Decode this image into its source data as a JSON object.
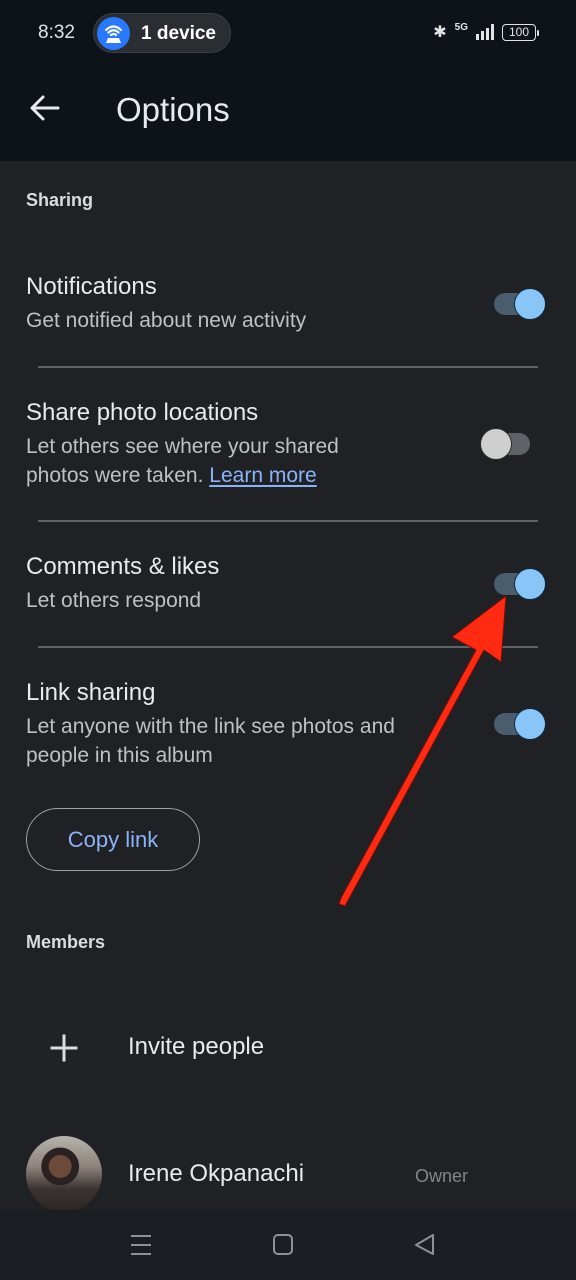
{
  "status_bar": {
    "time": "8:32",
    "hotspot_pill": {
      "icon": "wifi-hotspot-icon",
      "label": "1 device"
    },
    "network": "5G",
    "battery": "100"
  },
  "app_bar": {
    "back_icon": "arrow-back-icon",
    "title": "Options"
  },
  "sharing": {
    "header": "Sharing",
    "settings": [
      {
        "title": "Notifications",
        "subtitle": "Get notified about new activity",
        "enabled": true
      },
      {
        "title": "Share photo locations",
        "subtitle": "Let others see where your shared photos were taken.",
        "link": "Learn more",
        "enabled": false
      },
      {
        "title": "Comments & likes",
        "subtitle": "Let others respond",
        "enabled": true
      },
      {
        "title": "Link sharing",
        "subtitle": "Let anyone with the link see photos and people in this album",
        "enabled": true
      }
    ],
    "copy_link_label": "Copy link"
  },
  "members": {
    "header": "Members",
    "invite_label": "Invite people",
    "list": [
      {
        "name": "Irene Okpanachi",
        "role": "Owner"
      }
    ]
  },
  "nav_bar": {
    "buttons": [
      "menu-icon",
      "home-icon",
      "back-triangle-icon"
    ]
  },
  "colors": {
    "accent": "#8ab4f8",
    "toggle_on_thumb": "#8ac5f8",
    "annotation_arrow": "#ff2a12",
    "background": "#202124",
    "appbar": "#0e131a"
  },
  "annotation": {
    "type": "arrow",
    "points_to": "Comments & likes toggle"
  }
}
